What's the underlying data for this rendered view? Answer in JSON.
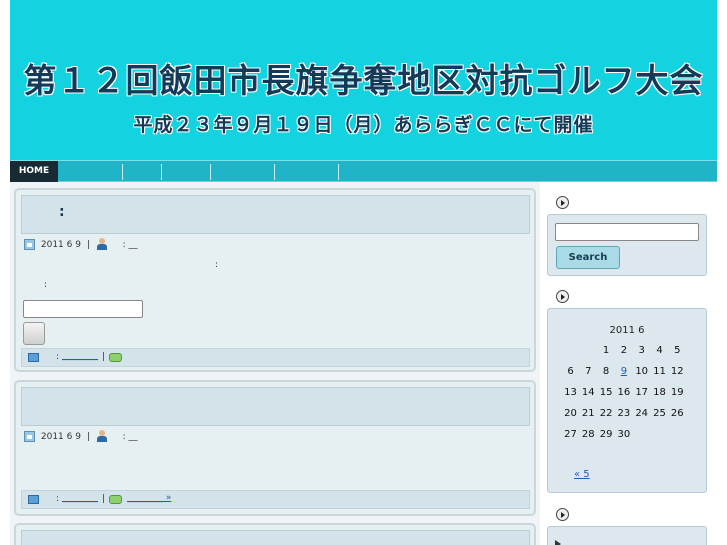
{
  "header": {
    "title": "第１２回飯田市長旗争奪地区対抗ゴルフ大会",
    "subtitle": "平成２３年９月１９日（月）あららぎＣＣにて開催"
  },
  "nav": {
    "home_label": "HOME"
  },
  "posts": [
    {
      "title": ":",
      "date": "2011 6 9",
      "author_label": ":",
      "author_link": "__",
      "body_colon_1": ":",
      "body_colon_2": ":",
      "footer_category_label": ":",
      "footer_category_link": "________"
    },
    {
      "title": "",
      "date": "2011 6 9",
      "author_label": ":",
      "author_link": "__",
      "footer_category_label": ":",
      "footer_category_link": "________",
      "footer_comment_link": "________ »"
    }
  ],
  "sidebar": {
    "search_label": "Search",
    "calendar": {
      "caption": "2011 6",
      "weeks": [
        [
          "",
          "",
          "1",
          "2",
          "3",
          "4",
          "5"
        ],
        [
          "6",
          "7",
          "8",
          "9",
          "10",
          "11",
          "12"
        ],
        [
          "13",
          "14",
          "15",
          "16",
          "17",
          "18",
          "19"
        ],
        [
          "20",
          "21",
          "22",
          "23",
          "24",
          "25",
          "26"
        ],
        [
          "27",
          "28",
          "29",
          "30",
          "",
          "",
          ""
        ]
      ],
      "linked_day": "9",
      "prev_link": "« 5"
    }
  },
  "colors": {
    "header_bg": "#14d3e0",
    "nav_bg": "#1fb4c8",
    "title_text": "#143a5a",
    "post_bg": "#e6f0f3",
    "link": "#1f5fae"
  }
}
